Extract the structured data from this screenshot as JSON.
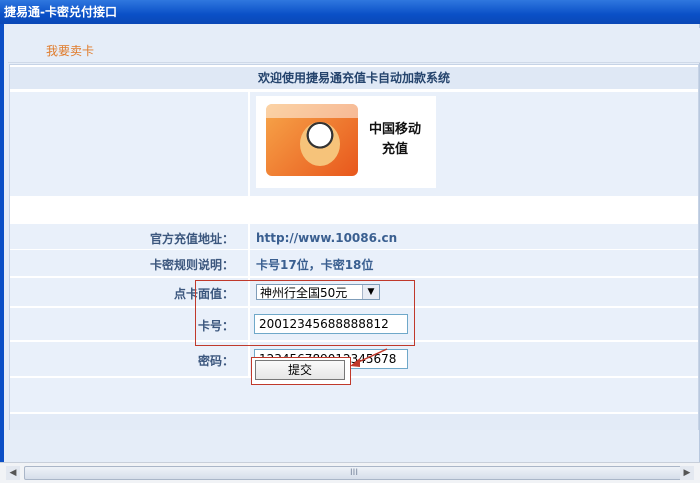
{
  "window": {
    "title": "捷易通-卡密兑付接口"
  },
  "top": {
    "sell_link": "我要卖卡"
  },
  "form": {
    "heading": "欢迎使用捷易通充值卡自动加款系统",
    "card_image": {
      "brand_text_line1": "中国移动",
      "brand_text_line2": "充值"
    },
    "official_site_label": "官方充值地址：",
    "official_site_value": "http://www.10086.cn",
    "rule_label": "卡密规则说明：",
    "rule_value": "卡号17位，卡密18位",
    "denomination_label": "点卡面值：",
    "denomination_selected": "神州行全国50元",
    "card_no_label": "卡号：",
    "card_no_value": "20012345688888812",
    "password_label": "密码：",
    "password_value": "123456789012345678",
    "submit_label": "提交"
  },
  "scrollbar": {
    "thumb_grip": "III"
  },
  "colors": {
    "accent": "#0b4fc6",
    "link": "#e07b2a",
    "highlight": "#c0392b"
  }
}
